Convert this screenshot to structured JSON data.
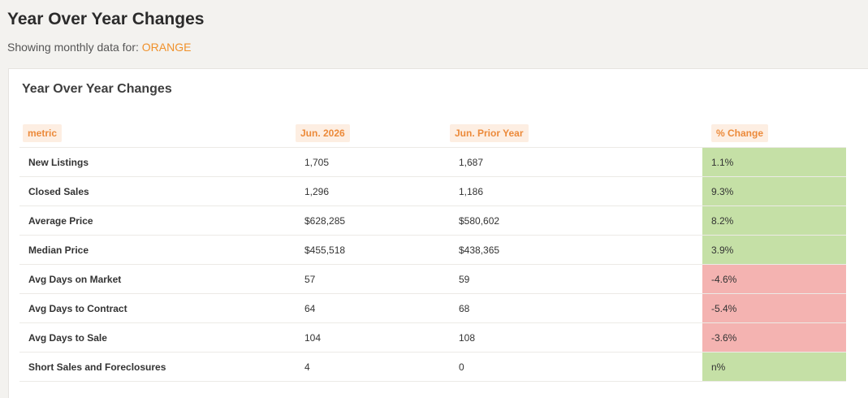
{
  "page": {
    "title": "Year Over Year Changes",
    "subtitle_prefix": "Showing monthly data for:",
    "county": "ORANGE"
  },
  "card": {
    "title": "Year Over Year Changes"
  },
  "table": {
    "headers": [
      "metric",
      "Jun. 2026",
      "Jun. Prior Year",
      "% Change"
    ],
    "rows": [
      {
        "metric": "New Listings",
        "current": "1,705",
        "prior": "1,687",
        "change": "1.1%",
        "direction": "positive"
      },
      {
        "metric": "Closed Sales",
        "current": "1,296",
        "prior": "1,186",
        "change": "9.3%",
        "direction": "positive"
      },
      {
        "metric": "Average Price",
        "current": "$628,285",
        "prior": "$580,602",
        "change": "8.2%",
        "direction": "positive"
      },
      {
        "metric": "Median Price",
        "current": "$455,518",
        "prior": "$438,365",
        "change": "3.9%",
        "direction": "positive"
      },
      {
        "metric": "Avg Days on Market",
        "current": "57",
        "prior": "59",
        "change": "-4.6%",
        "direction": "negative"
      },
      {
        "metric": "Avg Days to Contract",
        "current": "64",
        "prior": "68",
        "change": "-5.4%",
        "direction": "negative"
      },
      {
        "metric": "Avg Days to Sale",
        "current": "104",
        "prior": "108",
        "change": "-3.6%",
        "direction": "negative"
      },
      {
        "metric": "Short Sales and Foreclosures",
        "current": "4",
        "prior": "0",
        "change": "n%",
        "direction": "positive"
      }
    ]
  },
  "colors": {
    "accent": "#f0912b",
    "positive": "#c5e0a6",
    "negative": "#f4b3b1"
  }
}
